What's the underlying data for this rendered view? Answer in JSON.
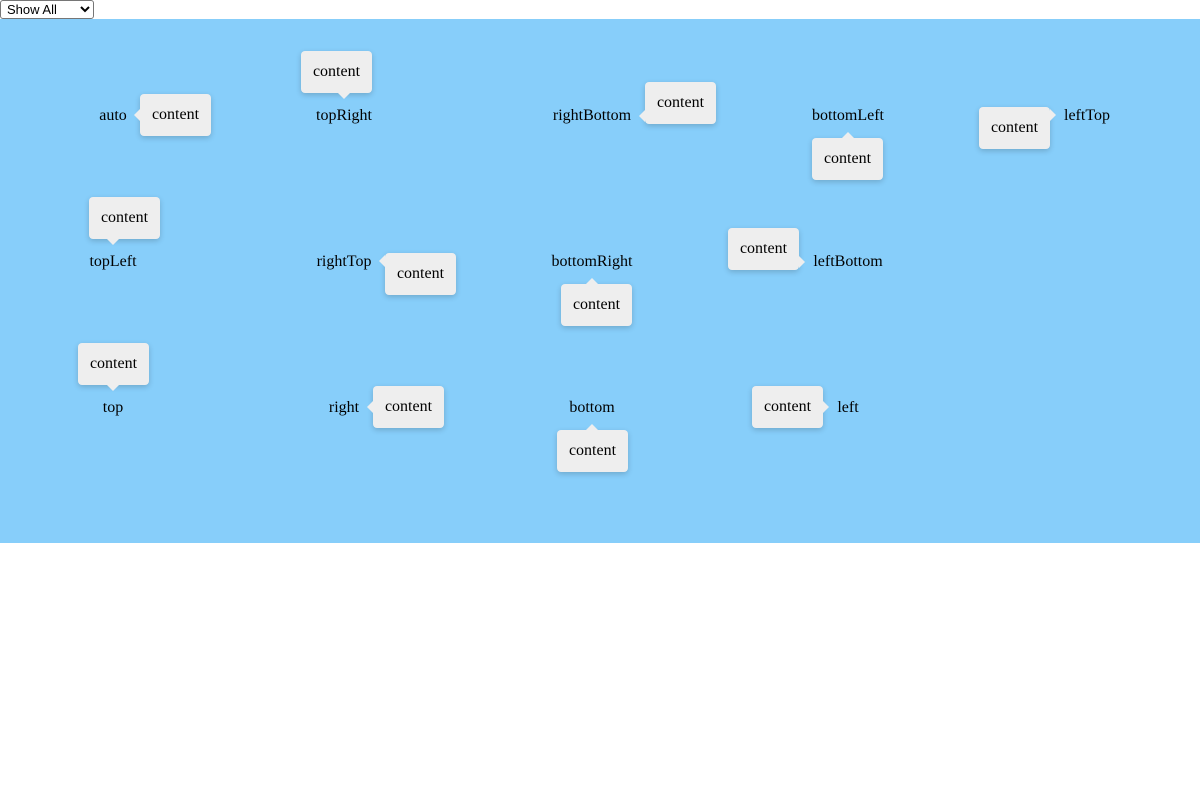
{
  "mode_select": {
    "selected": "Show All",
    "options": [
      "Show All"
    ]
  },
  "placements": [
    {
      "name": "auto",
      "label": "auto",
      "content": "content"
    },
    {
      "name": "topRight",
      "label": "topRight",
      "content": "content"
    },
    {
      "name": "rightBottom",
      "label": "rightBottom",
      "content": "content"
    },
    {
      "name": "bottomLeft",
      "label": "bottomLeft",
      "content": "content"
    },
    {
      "name": "leftTop",
      "label": "leftTop",
      "content": "content"
    },
    {
      "name": "topLeft",
      "label": "topLeft",
      "content": "content"
    },
    {
      "name": "rightTop",
      "label": "rightTop",
      "content": "content"
    },
    {
      "name": "bottomRight",
      "label": "bottomRight",
      "content": "content"
    },
    {
      "name": "leftBottom",
      "label": "leftBottom",
      "content": "content"
    },
    {
      "name": "top",
      "label": "top",
      "content": "content"
    },
    {
      "name": "right",
      "label": "right",
      "content": "content"
    },
    {
      "name": "bottom",
      "label": "bottom",
      "content": "content"
    },
    {
      "name": "left",
      "label": "left",
      "content": "content"
    }
  ],
  "colors": {
    "stage_background": "#87cefa",
    "bubble_background": "#eeeeee"
  }
}
